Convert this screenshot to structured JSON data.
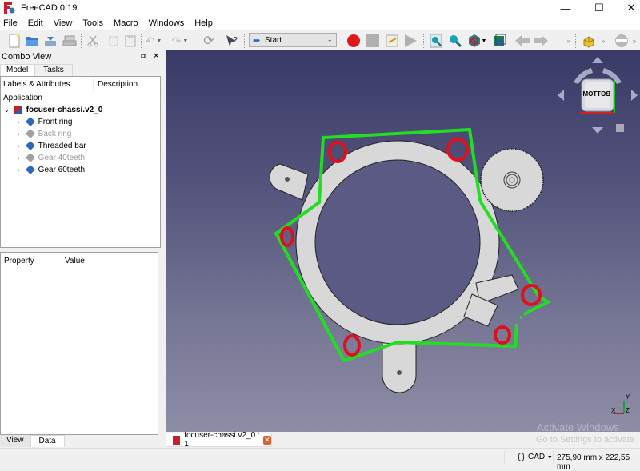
{
  "window": {
    "title": "FreeCAD 0.19",
    "controls": {
      "minimize": "—",
      "maximize": "☐",
      "close": "✕"
    }
  },
  "menu": [
    "File",
    "Edit",
    "View",
    "Tools",
    "Macro",
    "Windows",
    "Help"
  ],
  "toolbar": {
    "workbench_selector": "Start",
    "icons": [
      "new-file-icon",
      "open-folder-icon",
      "save-icon",
      "print-icon",
      "cut-icon",
      "copy-icon",
      "paste-icon",
      "undo-icon",
      "redo-icon",
      "refresh-icon",
      "whats-this-icon",
      "macro-record-icon",
      "macro-stop-icon",
      "macro-edit-icon",
      "macro-run-icon",
      "fit-all-icon",
      "fit-selection-icon",
      "draw-style-icon",
      "std-views-icon",
      "nav-back-icon",
      "nav-forward-icon",
      "part-icon",
      "section-icon"
    ]
  },
  "combo_view": {
    "title": "Combo View",
    "tabs": [
      "Model",
      "Tasks"
    ],
    "tree_headers": {
      "labels": "Labels & Attributes",
      "description": "Description"
    },
    "root_label": "Application",
    "document": "focuser-chassi.v2_0",
    "items": [
      {
        "label": "Front ring",
        "visible": true
      },
      {
        "label": "Back ring",
        "visible": false
      },
      {
        "label": "Threaded bar",
        "visible": true
      },
      {
        "label": "Gear 40teeth",
        "visible": false
      },
      {
        "label": "Gear 60teeth",
        "visible": true
      }
    ],
    "property_headers": {
      "property": "Property",
      "value": "Value"
    },
    "bottom_tabs": [
      "View",
      "Data"
    ]
  },
  "viewport": {
    "navcube_face": "BOTTOM",
    "axis_labels": {
      "x": "X",
      "y": "Y",
      "z": "Z"
    }
  },
  "document_tab": {
    "label": "focuser-chassi.v2_0 : 1"
  },
  "status": {
    "nav_style": "CAD",
    "dimensions": "275,90 mm x 222,55 mm"
  },
  "watermark": {
    "line1": "Activate Windows",
    "line2": "Go to Settings to activate"
  },
  "colors": {
    "accent_green": "#22dd22",
    "annotation_red": "#e0101a",
    "part_blue": "#2e6ab8",
    "part_grey": "#a0a0a0"
  }
}
